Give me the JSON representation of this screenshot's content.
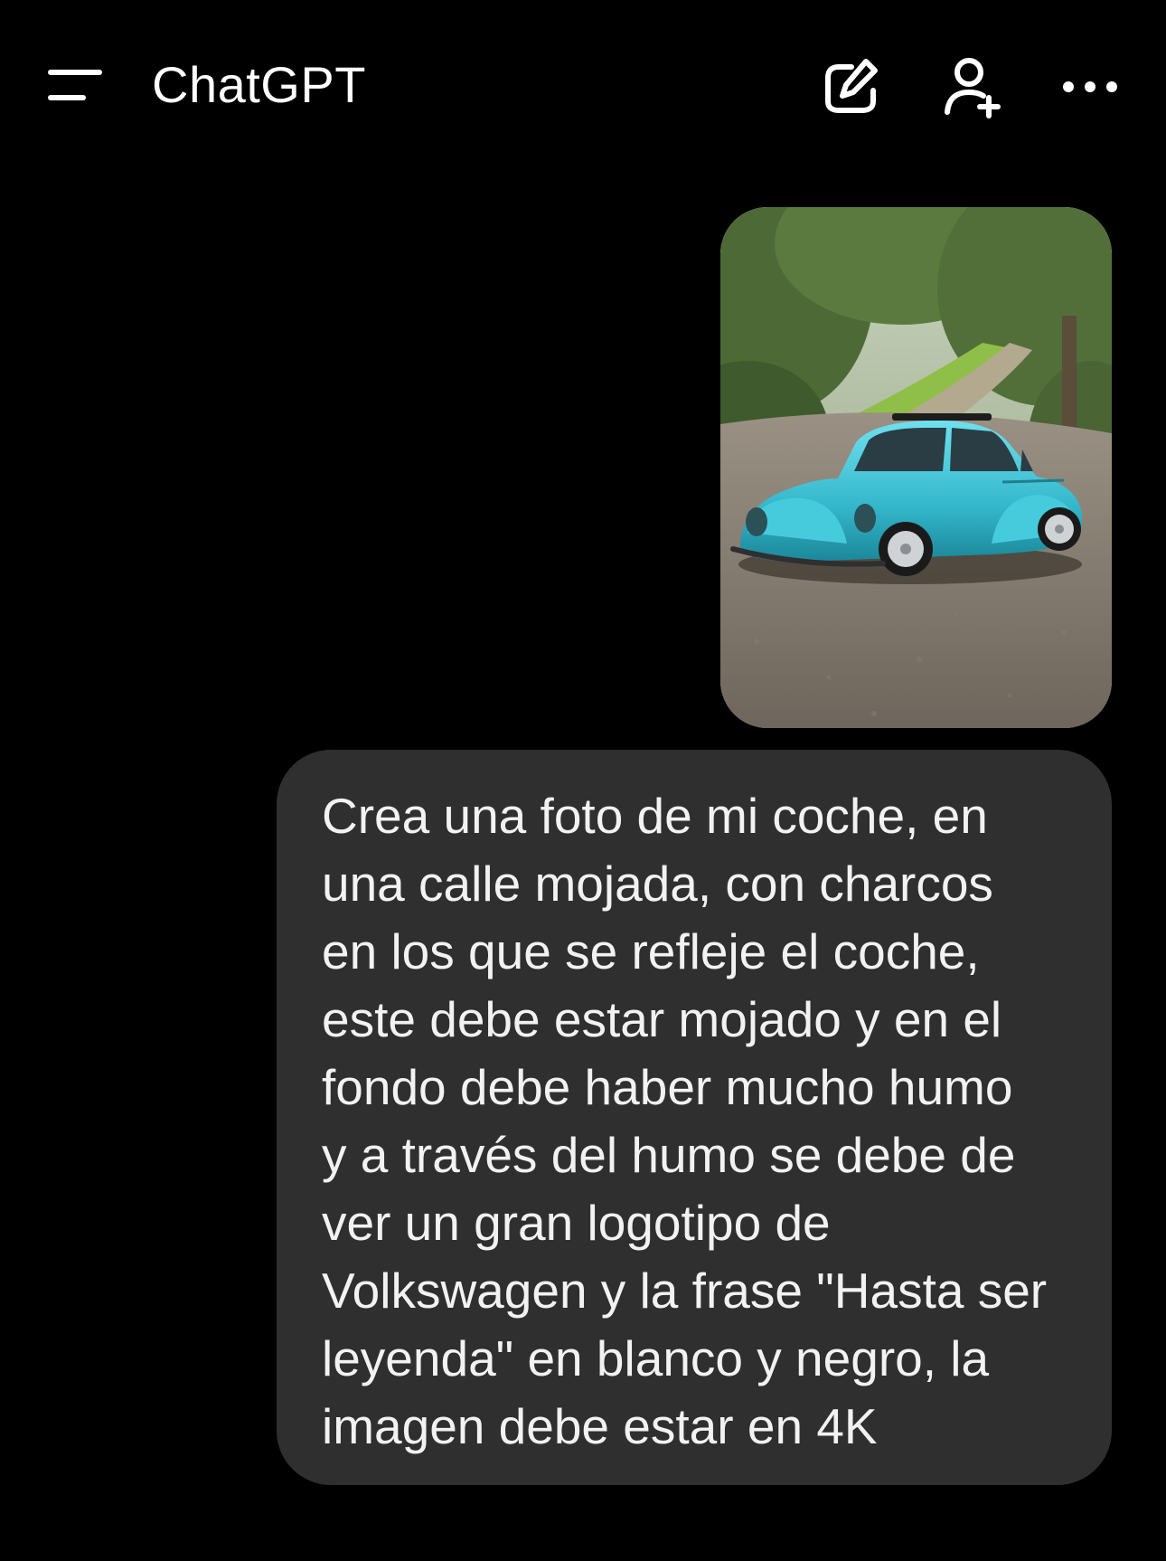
{
  "header": {
    "title": "ChatGPT",
    "menu_icon": "menu-icon",
    "actions": [
      {
        "name": "new-chat",
        "icon": "edit-icon"
      },
      {
        "name": "add-user",
        "icon": "add-user-icon"
      },
      {
        "name": "more",
        "icon": "ellipsis-icon"
      }
    ]
  },
  "conversation": {
    "user_message": {
      "image_alt": "",
      "text": "Crea una foto de mi coche, en\nuna calle mojada, con charcos\nen los que se refleje el coche,\neste debe estar mojado y en el\nfondo debe haber mucho humo\ny a través del humo se debe de\nver un gran logotipo de\nVolkswagen y la frase \"Hasta ser\nleyenda\" en blanco y negro, la\nimagen debe estar en 4K"
    }
  },
  "colors": {
    "background": "#000000",
    "bubble": "#2f2f2f",
    "text": "#f2f2f2",
    "car": "#3ec3d6"
  }
}
